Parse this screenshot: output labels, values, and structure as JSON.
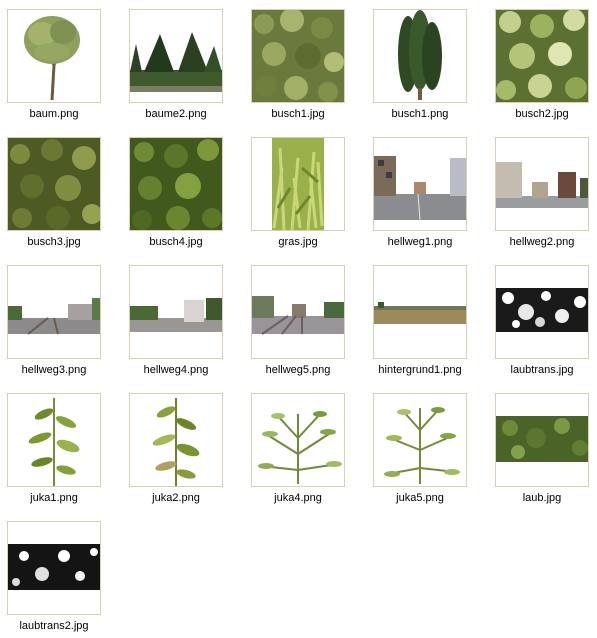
{
  "files": [
    {
      "name": "baum.png",
      "kind": "tree"
    },
    {
      "name": "baume2.png",
      "kind": "trees-row"
    },
    {
      "name": "busch1.jpg",
      "kind": "bush-texture"
    },
    {
      "name": "busch1.png",
      "kind": "cypress"
    },
    {
      "name": "busch2.jpg",
      "kind": "bush-texture-light"
    },
    {
      "name": "busch3.jpg",
      "kind": "bush-texture-dark"
    },
    {
      "name": "busch4.jpg",
      "kind": "bush-texture-green"
    },
    {
      "name": "gras.jpg",
      "kind": "grass"
    },
    {
      "name": "hellweg1.png",
      "kind": "street"
    },
    {
      "name": "hellweg2.png",
      "kind": "street"
    },
    {
      "name": "hellweg3.png",
      "kind": "street-wide"
    },
    {
      "name": "hellweg4.png",
      "kind": "street-wide"
    },
    {
      "name": "hellweg5.png",
      "kind": "street-wide"
    },
    {
      "name": "hintergrund1.png",
      "kind": "field"
    },
    {
      "name": "laubtrans.jpg",
      "kind": "mask"
    },
    {
      "name": "juka1.png",
      "kind": "plant-tall"
    },
    {
      "name": "juka2.png",
      "kind": "plant-tall"
    },
    {
      "name": "juka4.png",
      "kind": "plant-wide"
    },
    {
      "name": "juka5.png",
      "kind": "plant-wide"
    },
    {
      "name": "laub.jpg",
      "kind": "foliage-strip"
    },
    {
      "name": "laubtrans2.jpg",
      "kind": "mask"
    }
  ]
}
